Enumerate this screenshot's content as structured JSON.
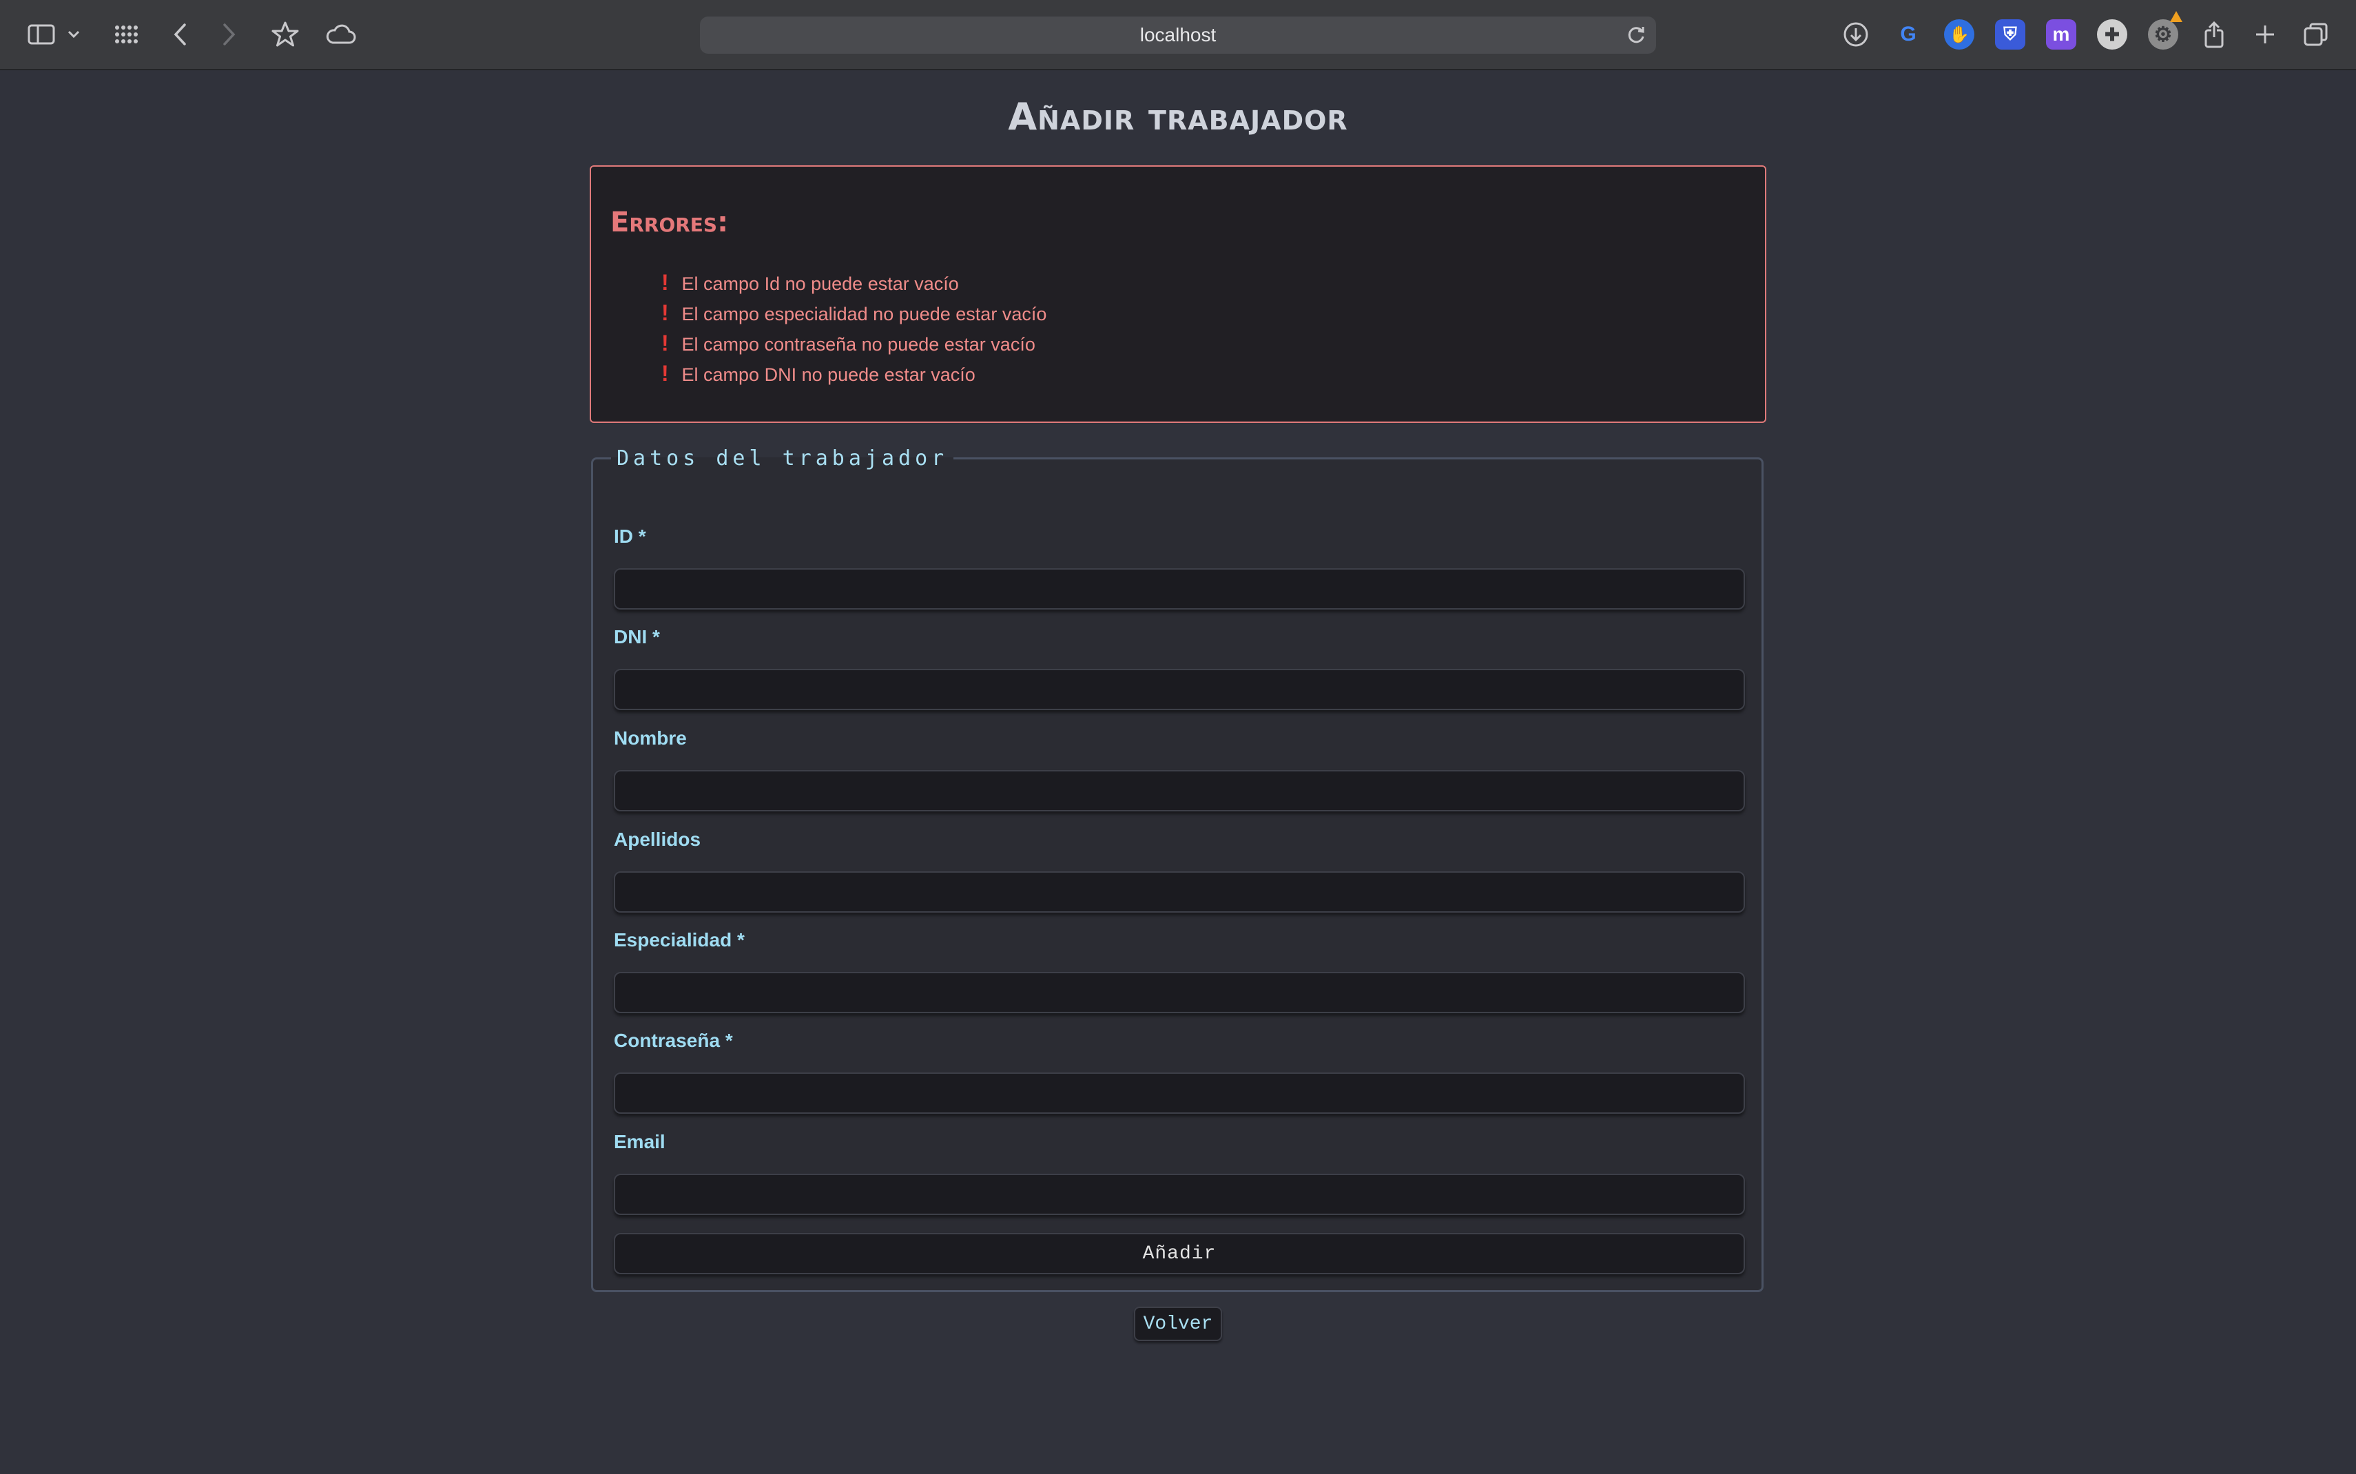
{
  "browser": {
    "url": "localhost",
    "icons": {
      "sidebar": "sidebar-icon",
      "chevron": "chevron-down-icon",
      "grid": "tab-grid-icon",
      "back": "back-arrow-icon",
      "forward": "forward-arrow-icon",
      "bookmark": "star-icon",
      "cloud": "cloud-icon",
      "reload": "reload-icon",
      "download": "download-icon",
      "share": "share-icon",
      "new_tab": "plus-icon",
      "tabs": "tabs-overview-icon"
    },
    "extensions": [
      {
        "name": "google-extension",
        "glyph": "G",
        "color": "#4285f4"
      },
      {
        "name": "blue-hand-extension",
        "glyph": "✋",
        "color": "#2f6fe0"
      },
      {
        "name": "shield-extension",
        "glyph": "⛨",
        "color": "#3a5bd9"
      },
      {
        "name": "purple-extension",
        "glyph": "m",
        "color": "#7b4fe0"
      },
      {
        "name": "gamepad-extension",
        "glyph": "✚",
        "color": "#d0d0d0"
      },
      {
        "name": "gear-extension",
        "glyph": "⚙",
        "color": "#9a9a9a"
      }
    ]
  },
  "page": {
    "title": "Añadir trabajador",
    "errors": {
      "title": "Errores:",
      "items": [
        "El campo Id no puede estar vacío",
        "El campo especialidad no puede estar vacío",
        "El campo contraseña no puede estar vacío",
        "El campo DNI no puede estar vacío"
      ],
      "bullet": "!"
    },
    "form": {
      "legend": "Datos del trabajador",
      "fields": {
        "id": {
          "label": "ID *",
          "value": ""
        },
        "dni": {
          "label": "DNI *",
          "value": ""
        },
        "nombre": {
          "label": "Nombre",
          "value": ""
        },
        "apellidos": {
          "label": "Apellidos",
          "value": ""
        },
        "especialidad": {
          "label": "Especialidad *",
          "value": ""
        },
        "contrasena": {
          "label": "Contraseña *",
          "value": ""
        },
        "email": {
          "label": "Email",
          "value": ""
        }
      },
      "submit_label": "Añadir"
    },
    "back_label": "Volver"
  }
}
